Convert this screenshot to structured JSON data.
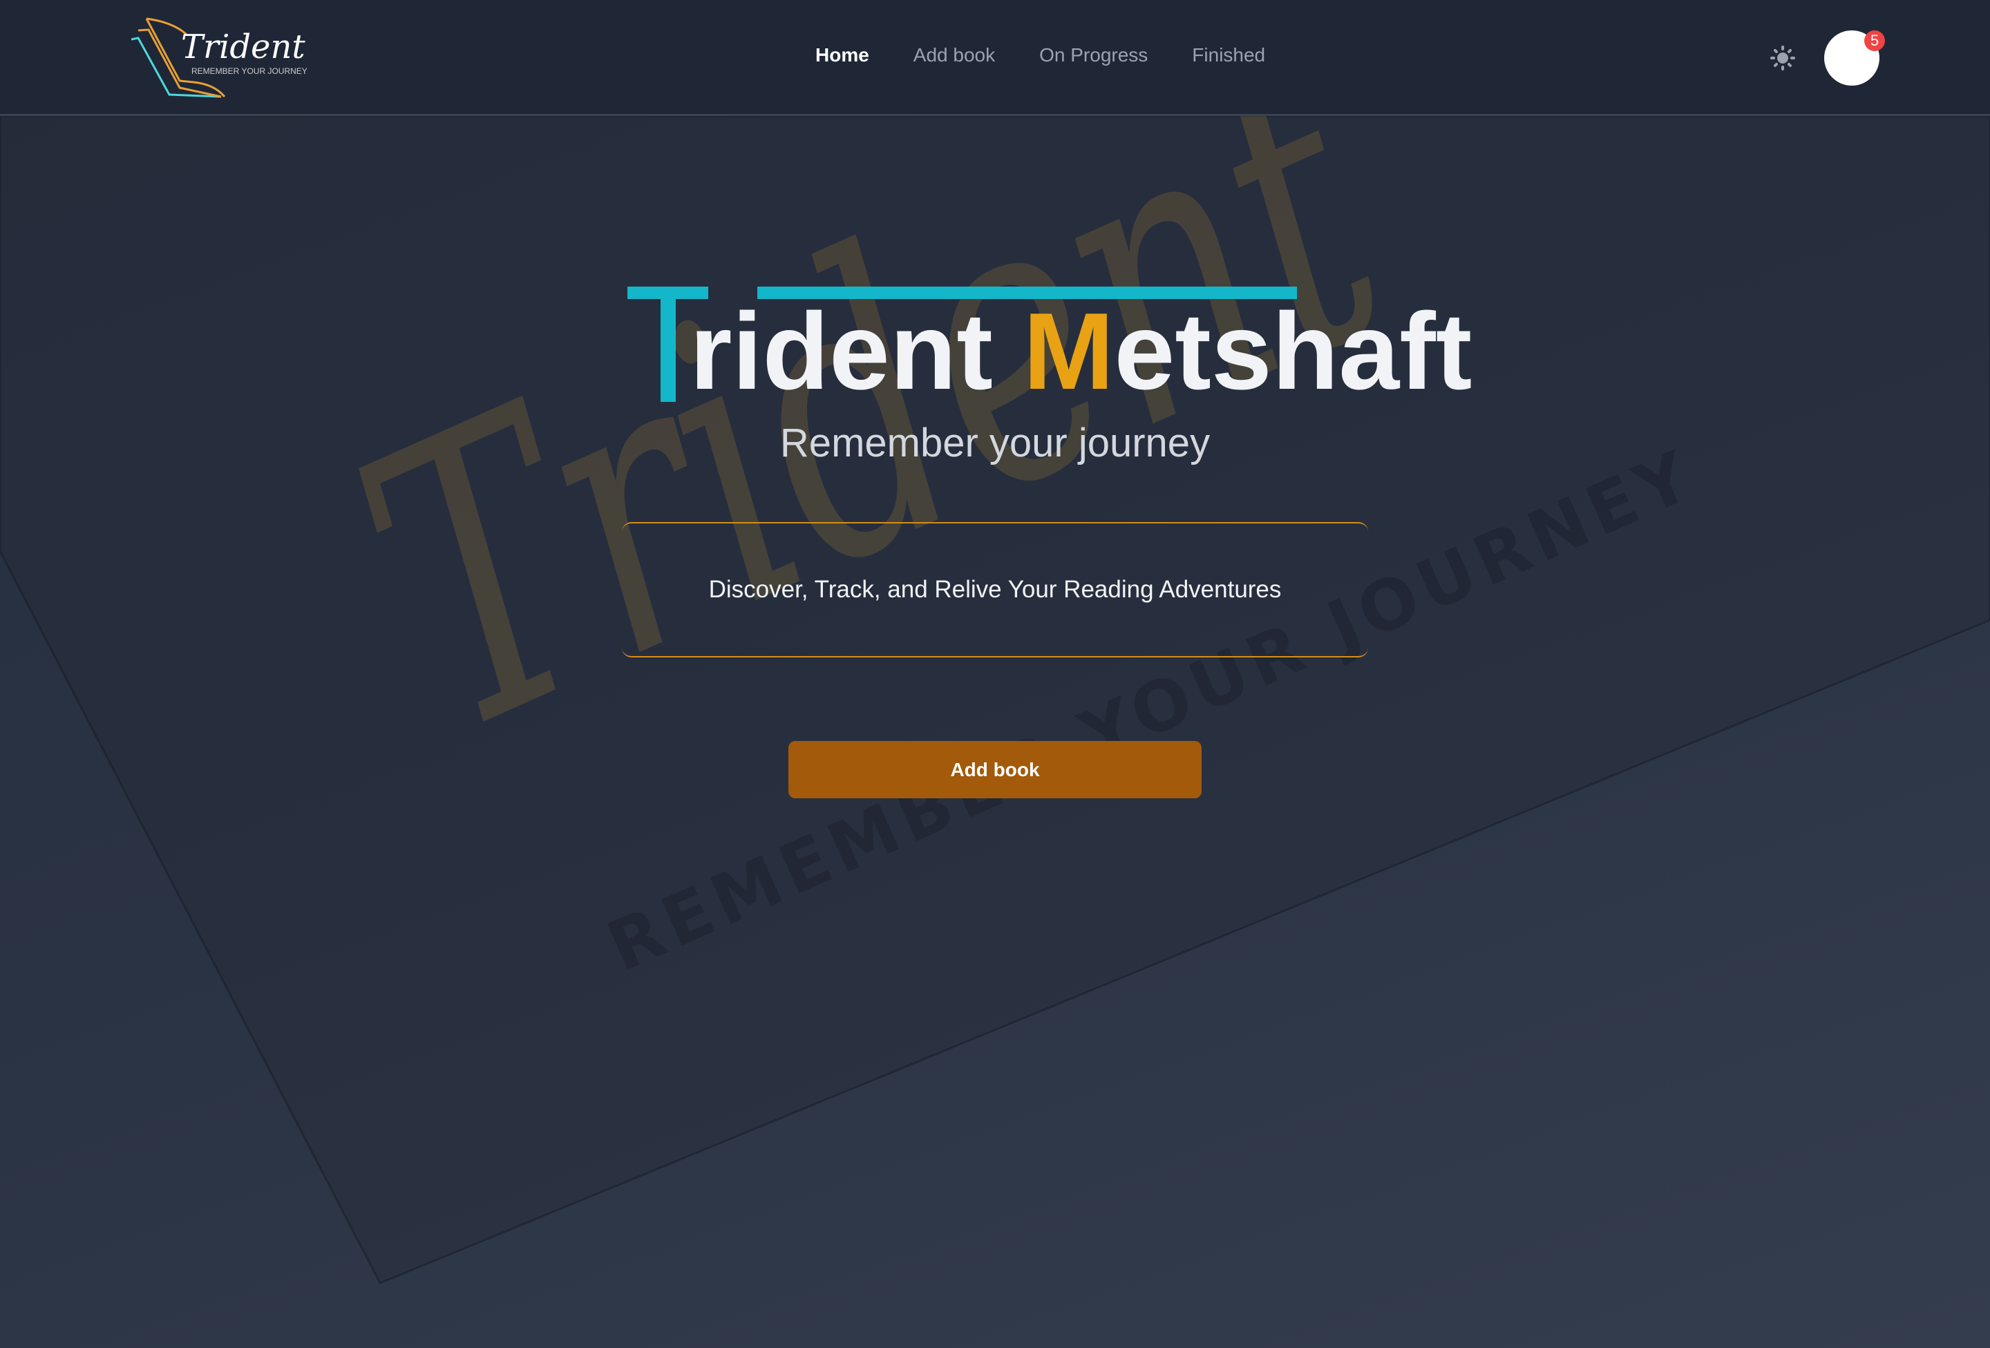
{
  "nav": {
    "logo": {
      "name": "Trident",
      "tagline": "REMEMBER YOUR JOURNEY"
    },
    "items": [
      {
        "label": "Home",
        "active": true
      },
      {
        "label": "Add book"
      },
      {
        "label": "On Progress"
      },
      {
        "label": "Finished"
      }
    ],
    "theme_icon": "sun-icon",
    "notification_count": "5"
  },
  "hero": {
    "title_first_letter": "T",
    "title_rest_1": "rident ",
    "title_accent_letter": "M",
    "title_rest_2": "etshaft",
    "subtitle": "Remember your journey",
    "description": "Discover, Track, and Relive Your Reading Adventures",
    "cta_label": "Add book"
  },
  "watermark": {
    "script": "Trident",
    "tagline": "REMEMBER YOUR JOURNEY"
  },
  "colors": {
    "accent_teal": "#13b7c9",
    "accent_orange": "#e8a213",
    "button": "#a35a0b",
    "nav_bg": "#1f2737",
    "badge": "#ef4444"
  }
}
